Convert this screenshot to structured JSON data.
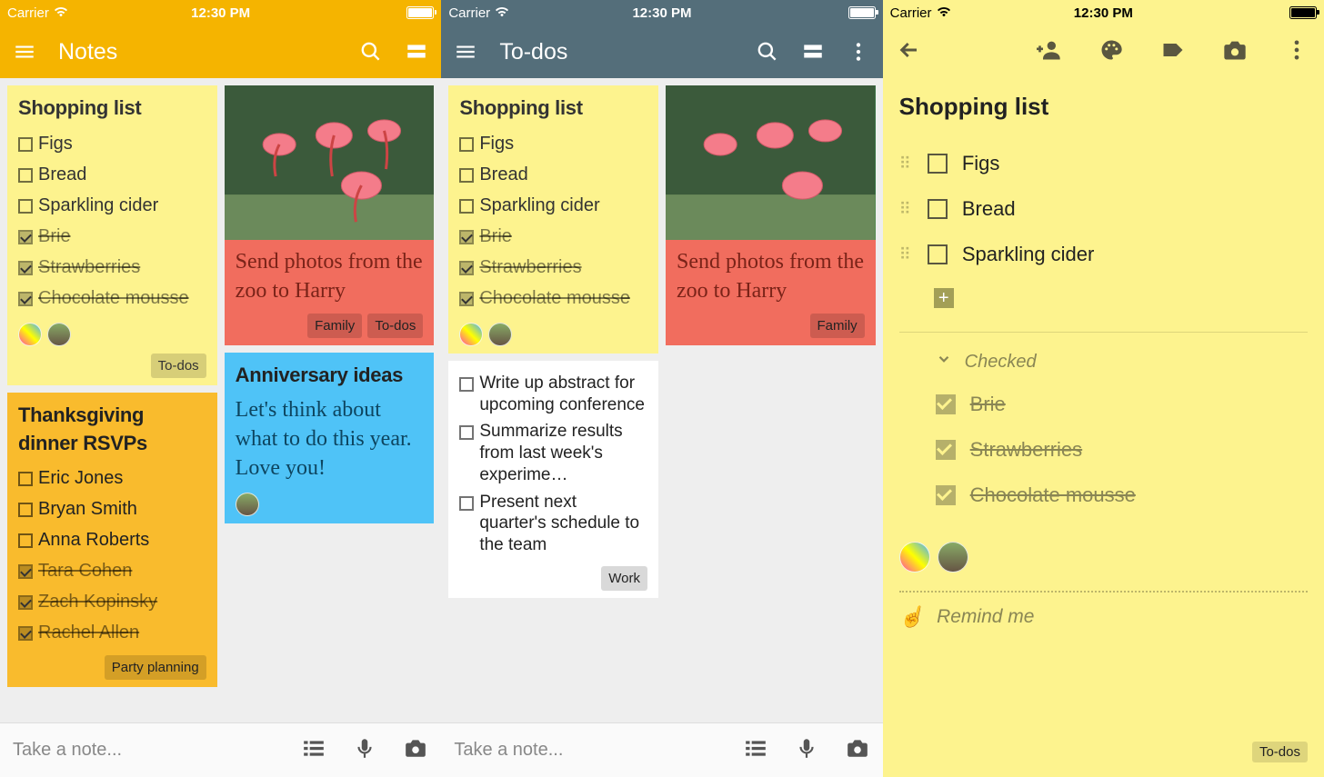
{
  "status": {
    "carrier": "Carrier",
    "time": "12:30 PM"
  },
  "screen1": {
    "title": "Notes",
    "compose_placeholder": "Take a note...",
    "shopping": {
      "title": "Shopping list",
      "items": [
        "Figs",
        "Bread",
        "Sparkling cider"
      ],
      "done": [
        "Brie",
        "Strawberries",
        "Chocolate mousse"
      ],
      "tag": "To-dos"
    },
    "rsvps": {
      "title": "Thanksgiving dinner RSVPs",
      "items": [
        "Eric Jones",
        "Bryan Smith",
        "Anna Roberts"
      ],
      "done": [
        "Tara Cohen",
        "Zach Kopinsky",
        "Rachel Allen"
      ],
      "tag": "Party planning"
    },
    "zoo": {
      "body": "Send photos from the zoo to Harry",
      "tags": [
        "Family",
        "To-dos"
      ]
    },
    "anniv": {
      "title": "Anniversary ideas",
      "body": "Let's think about what to do this year. Love you!"
    }
  },
  "screen2": {
    "title": "To-dos",
    "compose_placeholder": "Take a note...",
    "shopping": {
      "title": "Shopping list",
      "items": [
        "Figs",
        "Bread",
        "Sparkling cider"
      ],
      "done": [
        "Brie",
        "Strawberries",
        "Chocolate mousse"
      ]
    },
    "zoo": {
      "body": "Send photos from the zoo to Harry",
      "tag": "Family"
    },
    "work": {
      "items": [
        "Write up abstract for upcoming conference",
        "Summarize results from last week's experime…",
        "Present next quarter's schedule to the team"
      ],
      "tag": "Work"
    }
  },
  "screen3": {
    "title": "Shopping list",
    "items": [
      "Figs",
      "Bread",
      "Sparkling cider"
    ],
    "checked_label": "Checked",
    "done": [
      "Brie",
      "Strawberries",
      "Chocolate mousse"
    ],
    "remind": "Remind me",
    "tag": "To-dos"
  }
}
